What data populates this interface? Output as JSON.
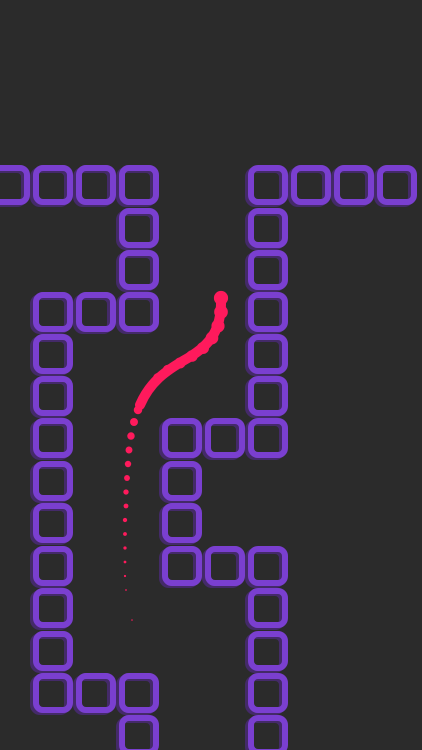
{
  "game": {
    "background_color": "#2b2b2b",
    "block_color": "#7a3fd0",
    "block_glow_color": "#5a2a9c",
    "snake_color": "#ff1a5c",
    "block_columns": [
      10,
      53,
      96,
      139,
      182,
      225,
      268,
      311,
      354,
      397
    ],
    "block_rows": [
      185,
      228,
      270,
      312,
      354,
      396,
      438,
      481,
      523,
      566,
      608,
      651,
      693,
      735
    ],
    "blocks": [
      [
        0,
        0
      ],
      [
        1,
        0
      ],
      [
        2,
        0
      ],
      [
        3,
        0
      ],
      [
        6,
        0
      ],
      [
        7,
        0
      ],
      [
        8,
        0
      ],
      [
        9,
        0
      ],
      [
        3,
        1
      ],
      [
        6,
        1
      ],
      [
        3,
        2
      ],
      [
        6,
        2
      ],
      [
        1,
        3
      ],
      [
        2,
        3
      ],
      [
        3,
        3
      ],
      [
        6,
        3
      ],
      [
        1,
        4
      ],
      [
        6,
        4
      ],
      [
        1,
        5
      ],
      [
        6,
        5
      ],
      [
        1,
        6
      ],
      [
        4,
        6
      ],
      [
        5,
        6
      ],
      [
        6,
        6
      ],
      [
        1,
        7
      ],
      [
        4,
        7
      ],
      [
        1,
        8
      ],
      [
        4,
        8
      ],
      [
        1,
        9
      ],
      [
        4,
        9
      ],
      [
        5,
        9
      ],
      [
        6,
        9
      ],
      [
        1,
        10
      ],
      [
        6,
        10
      ],
      [
        1,
        11
      ],
      [
        6,
        11
      ],
      [
        1,
        12
      ],
      [
        2,
        12
      ],
      [
        3,
        12
      ],
      [
        6,
        12
      ],
      [
        3,
        13
      ],
      [
        6,
        13
      ]
    ]
  }
}
